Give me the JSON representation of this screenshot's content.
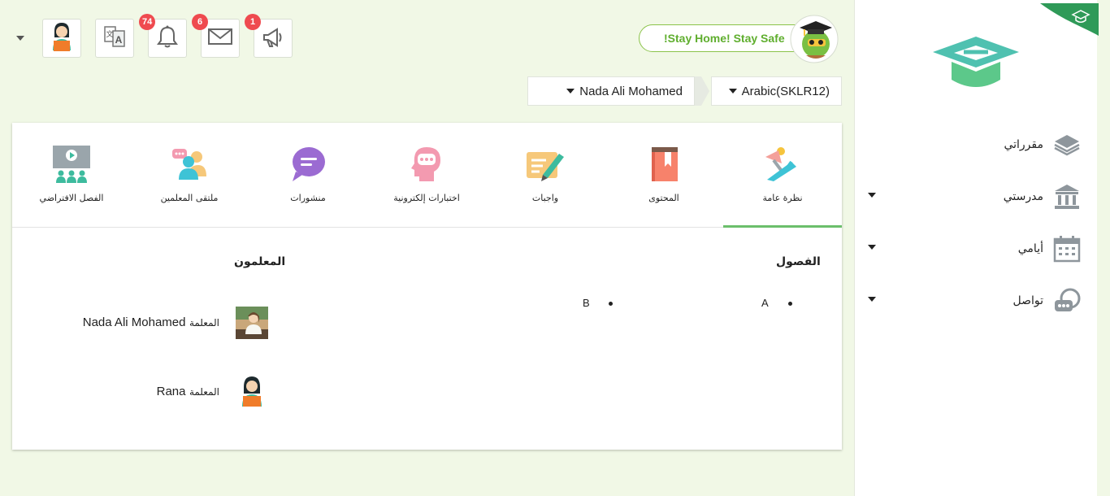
{
  "header": {
    "stay_home": "!Stay Home! Stay Safe",
    "icons": {
      "user": "user-teacher-icon",
      "translate": "translate-icon",
      "bell": "bell-icon",
      "mail": "mail-icon",
      "megaphone": "megaphone-icon"
    },
    "badges": {
      "notifications": "74",
      "messages": "6",
      "announcements": "1"
    },
    "user_dropdown": "Nada Ali Mohamed",
    "course_dropdown": "Arabic(SKLR12)"
  },
  "sidebar": {
    "items": [
      {
        "label": "مقرراتي",
        "icon": "layers-icon"
      },
      {
        "label": "مدرستي",
        "icon": "school-icon"
      },
      {
        "label": "أيامي",
        "icon": "calendar-icon"
      },
      {
        "label": "تواصل",
        "icon": "chat-icon"
      }
    ]
  },
  "tabs": [
    {
      "label": "نظرة عامة",
      "icon": "overview-lamp-icon",
      "active": true
    },
    {
      "label": "المحتوى",
      "icon": "content-book-icon"
    },
    {
      "label": "واجبات",
      "icon": "assignment-pen-icon"
    },
    {
      "label": "اختبارات إلكترونية",
      "icon": "quiz-head-icon"
    },
    {
      "label": "منشورات",
      "icon": "posts-chat-icon"
    },
    {
      "label": "ملتقى المعلمين",
      "icon": "teachers-forum-icon"
    },
    {
      "label": "الفصل الافتراضي",
      "icon": "virtual-class-icon"
    }
  ],
  "overview": {
    "classes_title": "الفصول",
    "classes": [
      "A",
      "B"
    ],
    "teachers_title": "المعلمون",
    "teachers": [
      {
        "role": "المعلمة",
        "name": "Nada Ali Mohamed"
      },
      {
        "role": "المعلمة",
        "name": "Rana"
      }
    ]
  },
  "colors": {
    "background": "#f1f8e6",
    "accent": "#6cbf6c",
    "badge": "#ef4a4f",
    "logo": "#4fc1b0"
  }
}
